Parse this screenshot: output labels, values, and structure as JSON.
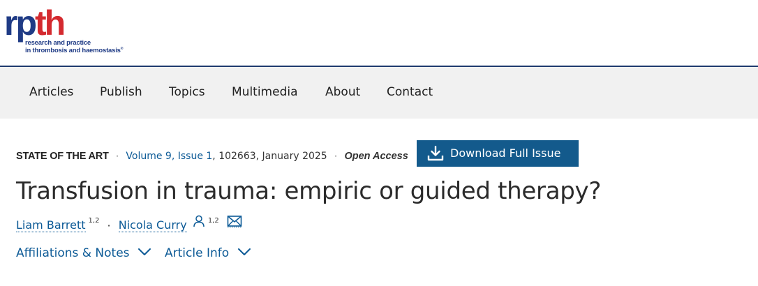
{
  "logo": {
    "word_part1": "rp",
    "word_part2": "th",
    "tagline_line1": "research and practice",
    "tagline_line2": "in thrombosis and haemostasis",
    "registered_mark": "®"
  },
  "nav": {
    "items": [
      {
        "label": "Articles"
      },
      {
        "label": "Publish"
      },
      {
        "label": "Topics"
      },
      {
        "label": "Multimedia"
      },
      {
        "label": "About"
      },
      {
        "label": "Contact"
      }
    ]
  },
  "article": {
    "type": "STATE OF THE ART",
    "separator": "·",
    "volume_issue": "Volume 9, Issue 1",
    "article_number_date": ", 102663, January 2025",
    "access": "Open Access",
    "download_button": "Download Full Issue",
    "title": "Transfusion in trauma: empiric or guided therapy?",
    "authors": [
      {
        "name": "Liam Barrett",
        "affiliations": "1,2"
      },
      {
        "name": "Nicola Curry",
        "affiliations": "1,2"
      }
    ],
    "affiliations_toggle": "Affiliations & Notes",
    "article_info_toggle": "Article Info"
  },
  "colors": {
    "brand_blue": "#1f3b85",
    "brand_red": "#d42a2f",
    "link": "#0c5a96",
    "button_bg": "#135a8c",
    "nav_bg": "#f1f1f1"
  },
  "icons": {
    "download": "download-icon",
    "person": "person-icon",
    "mail": "mail-icon",
    "chevron": "chevron-down-icon"
  }
}
